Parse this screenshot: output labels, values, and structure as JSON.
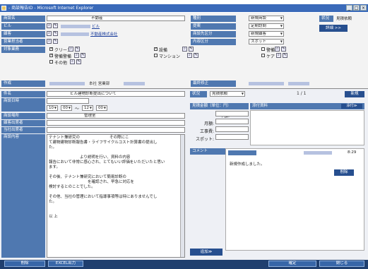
{
  "window": {
    "title": "- 商談報告ID - Microsoft Internet Explorer",
    "minimize": "_",
    "maximize": "□",
    "close": "×"
  },
  "header": {
    "labels": {
      "company": "商談名",
      "building": "ビル",
      "client": "顧客",
      "sales": "営業担当者",
      "target": "対象業務",
      "created": "作成",
      "type": "種別",
      "contract": "提案",
      "category": "商談先区分",
      "internal": "内容区分",
      "updated": "最終修正"
    },
    "company_value": "不動産",
    "building_link": "ビル",
    "client_link": "不動産株式会社",
    "type_value": "新規商談",
    "contract_value": "定期訪問",
    "category_value": "新規顧客",
    "internal_value": "スポット",
    "created_value": "本社 営業部",
    "status_label": "状況",
    "status_value": "見積依頼",
    "detail_button": "詳細 >>",
    "checkboxes": {
      "cleaning": "クリーン",
      "equipment": "設備",
      "security_guard": "警備",
      "guard": "警備警備",
      "mansion": "マンション",
      "care": "ケア",
      "other": "その他"
    }
  },
  "main": {
    "labels": {
      "subject": "件名",
      "datetime": "商談日時",
      "place": "商談場所",
      "client_attendee": "顧客出席者",
      "our_attendee": "当社出席者",
      "content": "商談内容"
    },
    "subject_value": "ビル建物診断提出について",
    "place_value": "管理室",
    "time_start_h": "10",
    "time_start_m": "00",
    "time_sep": "〜",
    "time_end_h": "12",
    "time_end_m": "00",
    "content_lines": [
      "テナント兼研究の 　　　　　　　 その際にこ",
      "て建物建物診断報告書・ライフサイクルコスト計算書の提出し",
      "た。",
      "",
      "　　　　　　　　より説明を行い、資料の内容",
      "報告において非常に感心され、とてもいい評価をいただいたと思い",
      "ます。",
      "",
      "その後、テナント兼研究において簡易診断の",
      "　　　　　　　　　　を確認され、早急に対応を",
      "検討するとのことでした。",
      "",
      "その他、当社の管理において指導事項等は特にありませんでし",
      "た。",
      "",
      "",
      "以 上"
    ],
    "right": {
      "status_label": "状況",
      "status_value": "見積依頼",
      "page": "1 / 1",
      "new_button": "新規",
      "estimate_header": "見積金額（単位：円）",
      "attach_header": "添付資料",
      "attach_button": "添付≫",
      "annual_label": "年額:",
      "monthly_label": "月額:",
      "construction_label": "工事費:",
      "spot_label": "スポット:",
      "comment_label": "コメント",
      "comment_time": "8:29",
      "comment_text": "新規作成しました。",
      "delete_comment": "削除",
      "add_button": "追加≫"
    }
  },
  "footer": {
    "delete": "削除",
    "excel": "EXCEL出力",
    "confirm": "確定",
    "close": "閉じる"
  }
}
